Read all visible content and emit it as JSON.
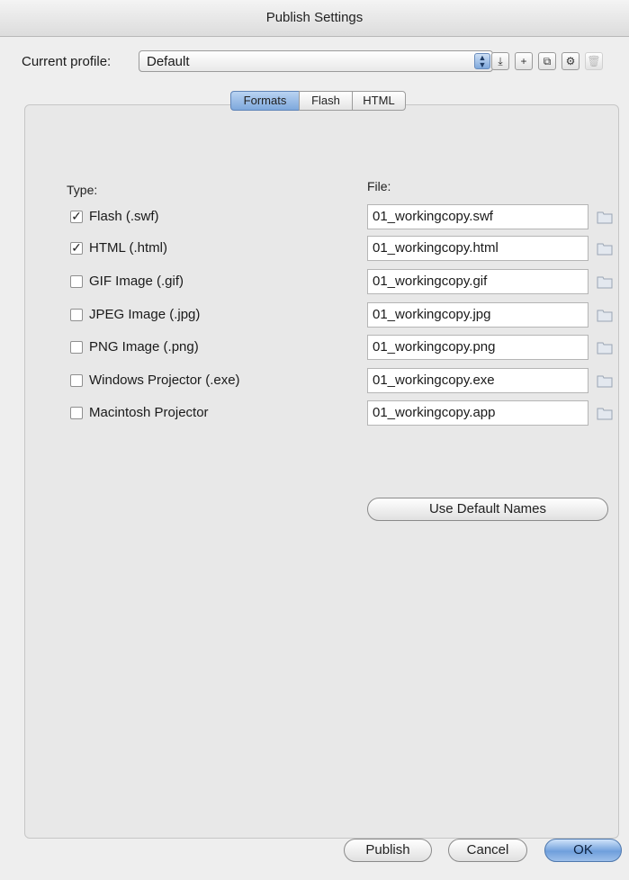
{
  "window": {
    "title": "Publish Settings"
  },
  "profile": {
    "label": "Current profile:",
    "value": "Default"
  },
  "toolbar": [
    {
      "name": "import-export-icon",
      "glyph": "⤓"
    },
    {
      "name": "add-profile-icon",
      "glyph": "+"
    },
    {
      "name": "duplicate-profile-icon",
      "glyph": "⧉"
    },
    {
      "name": "profile-settings-icon",
      "glyph": "⚙"
    },
    {
      "name": "delete-profile-icon",
      "glyph": "🗑"
    }
  ],
  "tabs": [
    {
      "label": "Formats",
      "active": true
    },
    {
      "label": "Flash",
      "active": false
    },
    {
      "label": "HTML",
      "active": false
    }
  ],
  "formats": {
    "type_label": "Type:",
    "file_label": "File:",
    "rows": [
      {
        "label": "Flash  (.swf)",
        "checked": true,
        "file": "01_workingcopy.swf"
      },
      {
        "label": "HTML (.html)",
        "checked": true,
        "file": "01_workingcopy.html"
      },
      {
        "label": "GIF Image (.gif)",
        "checked": false,
        "file": "01_workingcopy.gif"
      },
      {
        "label": "JPEG Image (.jpg)",
        "checked": false,
        "file": "01_workingcopy.jpg"
      },
      {
        "label": "PNG Image (.png)",
        "checked": false,
        "file": "01_workingcopy.png"
      },
      {
        "label": "Windows Projector (.exe)",
        "checked": false,
        "file": "01_workingcopy.exe"
      },
      {
        "label": "Macintosh Projector",
        "checked": false,
        "file": "01_workingcopy.app"
      }
    ],
    "default_names_button": "Use Default Names"
  },
  "buttons": {
    "publish": "Publish",
    "cancel": "Cancel",
    "ok": "OK"
  },
  "colors": {
    "accent": "#7ea8dc",
    "window_bg": "#eeeeee"
  }
}
